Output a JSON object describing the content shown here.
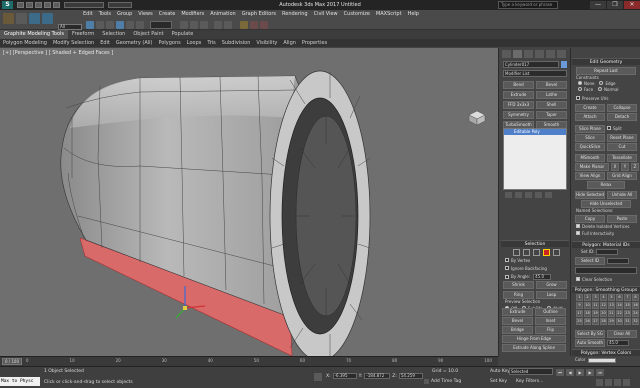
{
  "titlebar": {
    "title": "Autodesk 3ds Max 2017   Untitled",
    "search_placeholder": "Type a keyword or phrase",
    "window_buttons": [
      "—",
      "❐",
      "✕"
    ]
  },
  "menubar": [
    "Edit",
    "Tools",
    "Group",
    "Views",
    "Create",
    "Modifiers",
    "Animation",
    "Graph Editors",
    "Rendering",
    "Civil View",
    "Customize",
    "MAXScript",
    "Help"
  ],
  "toolbar": {
    "selection_filter": "All"
  },
  "ribbon": {
    "tabs": [
      "Graphite Modeling Tools",
      "Freeform",
      "Selection",
      "Object Paint",
      "Populate"
    ],
    "subtabs": [
      "Polygon Modeling",
      "Modify Selection",
      "Edit",
      "Geometry (All)",
      "Polygons",
      "Loops",
      "Tris",
      "Subdivision",
      "Visibility",
      "Align",
      "Properties"
    ]
  },
  "viewport": {
    "label": "[+] [Perspective ] [ Shaded + Edged Faces ]"
  },
  "command_panel": {
    "object_name": "Cylinder017",
    "modifier_list": "Modifier List",
    "modifiers": [
      [
        "Bend",
        "Bevel"
      ],
      [
        "Extrude",
        "Lathe"
      ],
      [
        "FFD 3x3x3",
        "Shell"
      ],
      [
        "Symmetry",
        "Taper"
      ],
      [
        "TurboSmooth",
        "Smooth"
      ]
    ],
    "stack_item": "Editable Poly",
    "selection": {
      "header": "Selection",
      "by_vertex": "By Vertex",
      "ignore_backfacing": "Ignore Backfacing",
      "by_angle": "By Angle:",
      "by_angle_value": "45.0",
      "shrink": "Shrink",
      "grow": "Grow",
      "ring": "Ring",
      "loop": "Loop",
      "preview_selection": "Preview Selection",
      "preview_options": [
        "Off",
        "SubObj",
        "Multi"
      ],
      "status": "10 Polygons Selected"
    },
    "soft_selection": "Soft Selection",
    "edit_polygons": {
      "header": "Edit Polygons",
      "insert_vertex": "Insert Vertex",
      "rows": [
        [
          "Extrude",
          "Outline"
        ],
        [
          "Bevel",
          "Inset"
        ],
        [
          "Bridge",
          "Flip"
        ]
      ],
      "hinge": "Hinge From Edge",
      "extrude_spline": "Extrude Along Spline",
      "edit_tri": "Edit Triangulation",
      "retriangulate": "Retriangulate",
      "turn": "Turn"
    }
  },
  "edit_geometry": {
    "header": "Edit Geometry",
    "repeat_last": "Repeat Last",
    "constraints": "Constraints",
    "constraint_options": [
      "None",
      "Edge",
      "Face",
      "Normal"
    ],
    "preserve_uvs": "Preserve UVs",
    "rows1": [
      [
        "Create",
        "Collapse"
      ],
      [
        "Attach",
        "Detach"
      ]
    ],
    "slice_plane": "Slice Plane",
    "split": "Split",
    "rows2": [
      [
        "Slice",
        "Reset Plane"
      ],
      [
        "QuickSlice",
        "Cut"
      ]
    ],
    "msmooth": "MSmooth",
    "tessellate": "Tessellate",
    "make_planar": "Make Planar",
    "xyz": [
      "X",
      "Y",
      "Z"
    ],
    "rows3": [
      [
        "View Align",
        "Grid Align"
      ]
    ],
    "relax": "Relax",
    "rows4": [
      [
        "Hide Selected",
        "Unhide All"
      ]
    ],
    "hide_unselected": "Hide Unselected",
    "named_selections": "Named Selections:",
    "copy": "Copy",
    "paste": "Paste",
    "delete_isolated": "Delete Isolated Vertices",
    "full_interactivity": "Full Interactivity"
  },
  "material_ids": {
    "header": "Polygon: Material IDs",
    "set_id": "Set ID:",
    "select_id": "Select ID",
    "clear_selection": "Clear Selection"
  },
  "smoothing_groups": {
    "header": "Polygon: Smoothing Groups",
    "numbers": [
      "1",
      "2",
      "3",
      "4",
      "5",
      "6",
      "7",
      "8",
      "9",
      "10",
      "11",
      "12",
      "13",
      "14",
      "15",
      "16",
      "17",
      "18",
      "19",
      "20",
      "21",
      "22",
      "23",
      "24",
      "25",
      "26",
      "27",
      "28",
      "29",
      "30",
      "31",
      "32"
    ],
    "select_by_sg": "Select By SG",
    "clear_all": "Clear All",
    "auto_smooth": "Auto Smooth",
    "auto_smooth_value": "45.0"
  },
  "vertex_colors": {
    "header": "Polygon: Vertex Colors",
    "color": "Color"
  },
  "timeline": {
    "frame": "0 / 100",
    "ticks": [
      "0",
      "10",
      "20",
      "30",
      "40",
      "50",
      "60",
      "70",
      "80",
      "90",
      "100"
    ]
  },
  "status": {
    "maxscript": "Max to Physc",
    "selected": "1 Object Selected",
    "prompt": "Click or click-and-drag to select objects",
    "x_label": "X:",
    "x_value": "-6.395",
    "y_label": "Y:",
    "y_value": "-184.872",
    "z_label": "Z:",
    "z_value": "54.259",
    "grid": "Grid = 10.0",
    "add_time_tag": "Add Time Tag",
    "auto_key": "Auto Key",
    "auto_key_mode": "Selected",
    "set_key": "Set Key",
    "key_filters": "Key Filters..."
  }
}
